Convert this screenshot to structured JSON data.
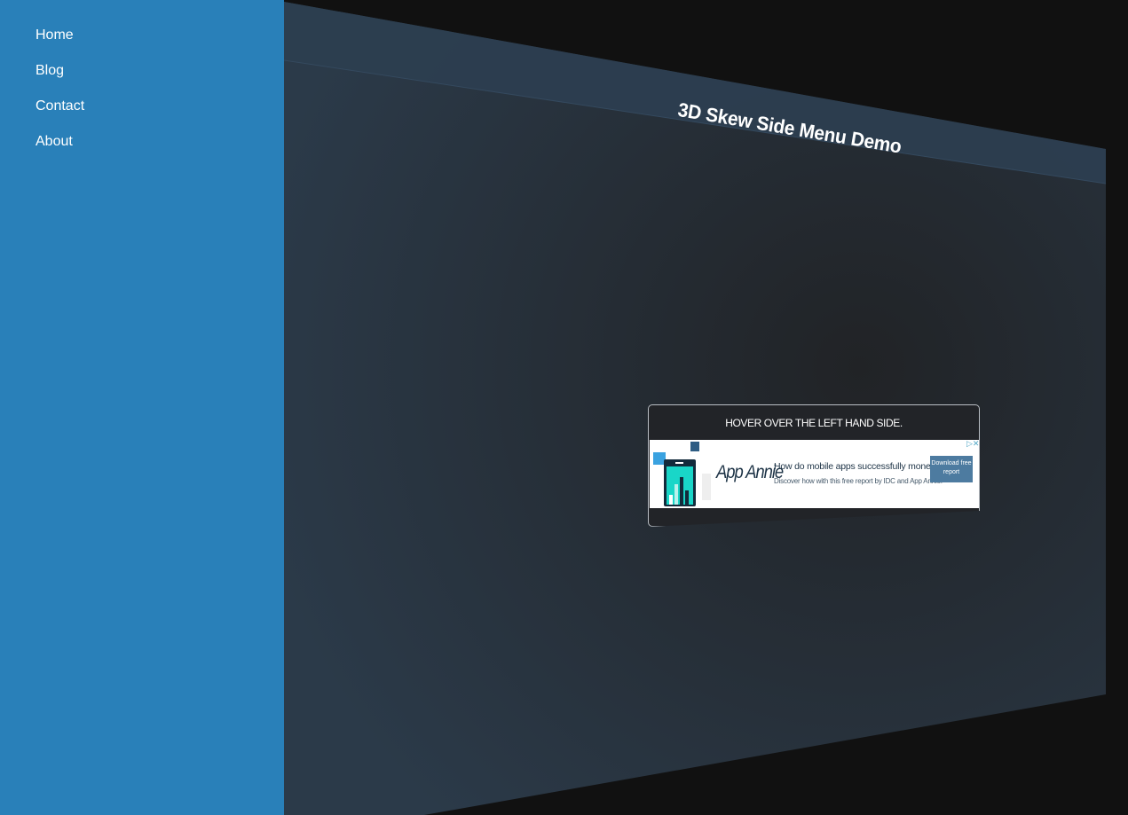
{
  "sidebar": {
    "items": [
      {
        "label": "Home"
      },
      {
        "label": "Blog"
      },
      {
        "label": "Contact"
      },
      {
        "label": "About"
      }
    ]
  },
  "main": {
    "title": "3D Skew Side Menu Demo",
    "notice": "HOVER OVER THE LEFT HAND SIDE."
  },
  "ad": {
    "brand": "App Annie",
    "headline": "How do mobile apps successfully monetize?",
    "subtext": "Discover how with this free report by IDC and App Annie.",
    "cta": "Download free report",
    "close_icon": "close-icon"
  },
  "colors": {
    "sidebar": "#2980b9",
    "panel": "#262c33",
    "header_band": "#2c3e50",
    "background": "#111111"
  }
}
